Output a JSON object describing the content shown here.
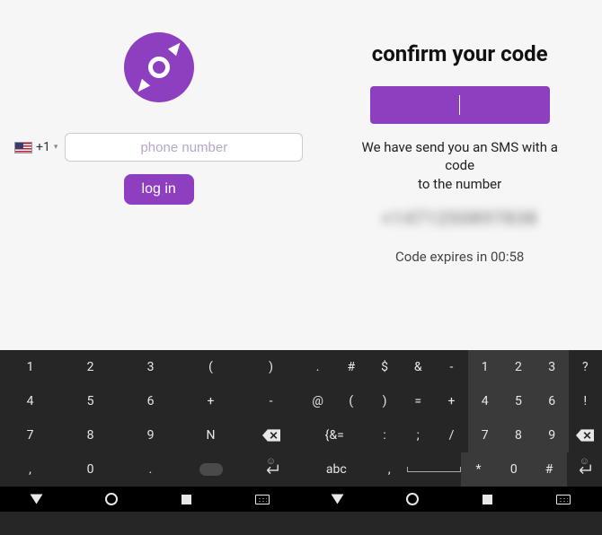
{
  "left": {
    "country_code": "+1",
    "phone_placeholder": "phone number",
    "login_label": "log in"
  },
  "right": {
    "title": "confirm your code",
    "sms_text_l1": "We have send you an SMS with a code",
    "sms_text_l2": "to the number",
    "blurred_number": "+1471250897838",
    "expires_prefix": "Code expires in ",
    "expires_time": "00:58"
  },
  "keyboard": {
    "left_rows": [
      [
        "1",
        "2",
        "3",
        "(",
        ")"
      ],
      [
        "4",
        "5",
        "6",
        "+",
        "-"
      ],
      [
        "7",
        "8",
        "9",
        "N",
        "⌫"
      ],
      [
        ",",
        "0",
        ".",
        "▭",
        "↵"
      ]
    ],
    "right_rows": [
      [
        ".",
        "#",
        "$",
        "&",
        "-",
        "1",
        "2",
        "3",
        "?"
      ],
      [
        "@",
        "(",
        ")",
        "=",
        "+",
        "4",
        "5",
        "6",
        "!"
      ],
      [
        "{&=",
        ":",
        ";",
        "/",
        "7",
        "8",
        "9",
        "⌫"
      ],
      [
        "abc",
        ",",
        "␣",
        "*",
        "0",
        "#",
        "↵"
      ]
    ]
  }
}
